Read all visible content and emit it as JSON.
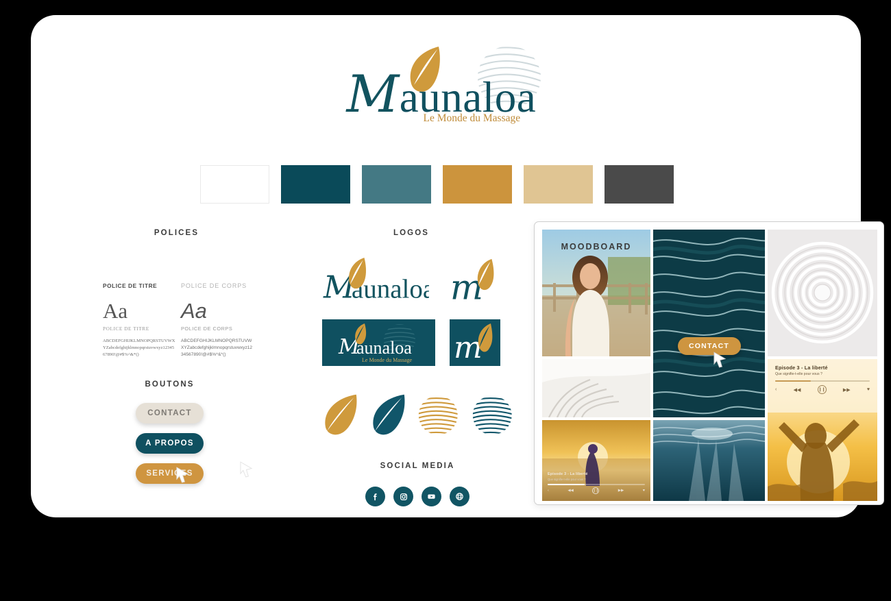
{
  "brand": {
    "name": "Maunaloa",
    "name_initial": "M",
    "name_rest": "aunaloa",
    "tagline": "Le Monde du Massage"
  },
  "palette": {
    "swatches": [
      {
        "name": "blanc",
        "hex": "#FFFFFF"
      },
      {
        "name": "bleu-canard",
        "hex": "#0A4A59"
      },
      {
        "name": "bleu-gris",
        "hex": "#447984"
      },
      {
        "name": "or",
        "hex": "#CC943D"
      },
      {
        "name": "beige",
        "hex": "#E0C593"
      },
      {
        "name": "gris-fonce",
        "hex": "#4A4A4A"
      }
    ]
  },
  "sections": {
    "polices": "POLICES",
    "logos": "LOGOS",
    "boutons": "BOUTONS",
    "social_media": "SOCIAL MEDIA",
    "moodboard": "MOODBOARD"
  },
  "typography": {
    "title_font": {
      "heading": "POLICE DE TITRE",
      "sample": "Aa",
      "caption": "POLICE DE TITRE",
      "alphabet": "ABCDEFGHIJKLMNOPQRSTUVWXYZabcdefghijklmnopqrstuvwxyz1234567890!@#$%^&*()"
    },
    "body_font": {
      "heading": "POLICE DE CORPS",
      "sample": "Aa",
      "caption": "POLICE DE CORPS",
      "alphabet": "ABCDEFGHIJKLMNOPQRSTUVWXYZabcdefghijklmnopqrstuvwxyz1234567890!@#$%^&*()"
    }
  },
  "buttons": [
    {
      "label": "CONTACT",
      "style": "cream"
    },
    {
      "label": "A PROPOS",
      "style": "teal"
    },
    {
      "label": "SERVICES",
      "style": "gold"
    }
  ],
  "social": [
    {
      "name": "facebook-icon"
    },
    {
      "name": "instagram-icon"
    },
    {
      "name": "youtube-icon"
    },
    {
      "name": "website-globe-icon"
    }
  ],
  "moodboard": {
    "cta_label": "CONTACT",
    "player": {
      "title": "Episode 3 - La liberté",
      "subtitle": "Que signifie-t-elle pour vous ?",
      "share": "‹",
      "prev": "◀◀",
      "play": "❙❙",
      "next": "▶▶",
      "like": "♥"
    }
  }
}
